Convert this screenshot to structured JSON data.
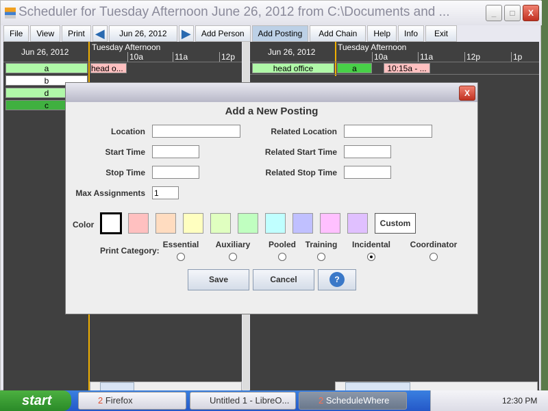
{
  "window": {
    "title": "Scheduler for Tuesday Afternoon June 26, 2012 from C:\\Documents and ...",
    "minimize": "_",
    "maximize": "□",
    "close": "X"
  },
  "toolbar": {
    "file": "File",
    "view": "View",
    "print": "Print",
    "prev": "◀",
    "date": "Jun 26, 2012",
    "next": "▶",
    "add_person": "Add Person",
    "add_posting": "Add Posting",
    "add_chain": "Add Chain",
    "help": "Help",
    "info": "Info",
    "exit": "Exit"
  },
  "left_pane": {
    "date": "Jun 26, 2012",
    "period": "Tuesday Afternoon",
    "hours": [
      "10a",
      "11a",
      "12p"
    ],
    "people": [
      "a",
      "b",
      "d",
      "c"
    ],
    "entry": "head o..."
  },
  "right_pane": {
    "date": "Jun 26, 2012",
    "period": "Tuesday Afternoon",
    "hours": [
      "10a",
      "11a",
      "12p",
      "1p"
    ],
    "posting": "head office",
    "person": "a",
    "entry": "10:15a - ..."
  },
  "dialog": {
    "title": "Add a New Posting",
    "close": "X",
    "location_label": "Location",
    "location": "",
    "start_label": "Start Time",
    "start": "",
    "stop_label": "Stop Time",
    "stop": "",
    "max_label": "Max Assignments",
    "max": "1",
    "rel_location_label": "Related Location",
    "rel_location": "",
    "rel_start_label": "Related Start Time",
    "rel_start": "",
    "rel_stop_label": "Related Stop Time",
    "rel_stop": "",
    "color_label": "Color",
    "colors": [
      "#ffffff",
      "#ffc0c0",
      "#ffdcc0",
      "#ffffc0",
      "#e0ffc0",
      "#c0ffc0",
      "#c0ffff",
      "#c0c0ff",
      "#ffc0ff",
      "#e0c0ff"
    ],
    "custom": "Custom",
    "print_category_label": "Print Category:",
    "categories": [
      "Essential",
      "Auxiliary",
      "Pooled",
      "Training",
      "Incidental",
      "Coordinator"
    ],
    "selected_category": "Incidental",
    "save": "Save",
    "cancel": "Cancel",
    "help": "?"
  },
  "taskbar": {
    "start": "start",
    "tasks": [
      {
        "count": "2",
        "label": "Firefox"
      },
      {
        "label": "Untitled 1 - LibreO..."
      },
      {
        "count": "2",
        "label": "ScheduleWhere"
      }
    ],
    "clock": "12:30 PM"
  }
}
